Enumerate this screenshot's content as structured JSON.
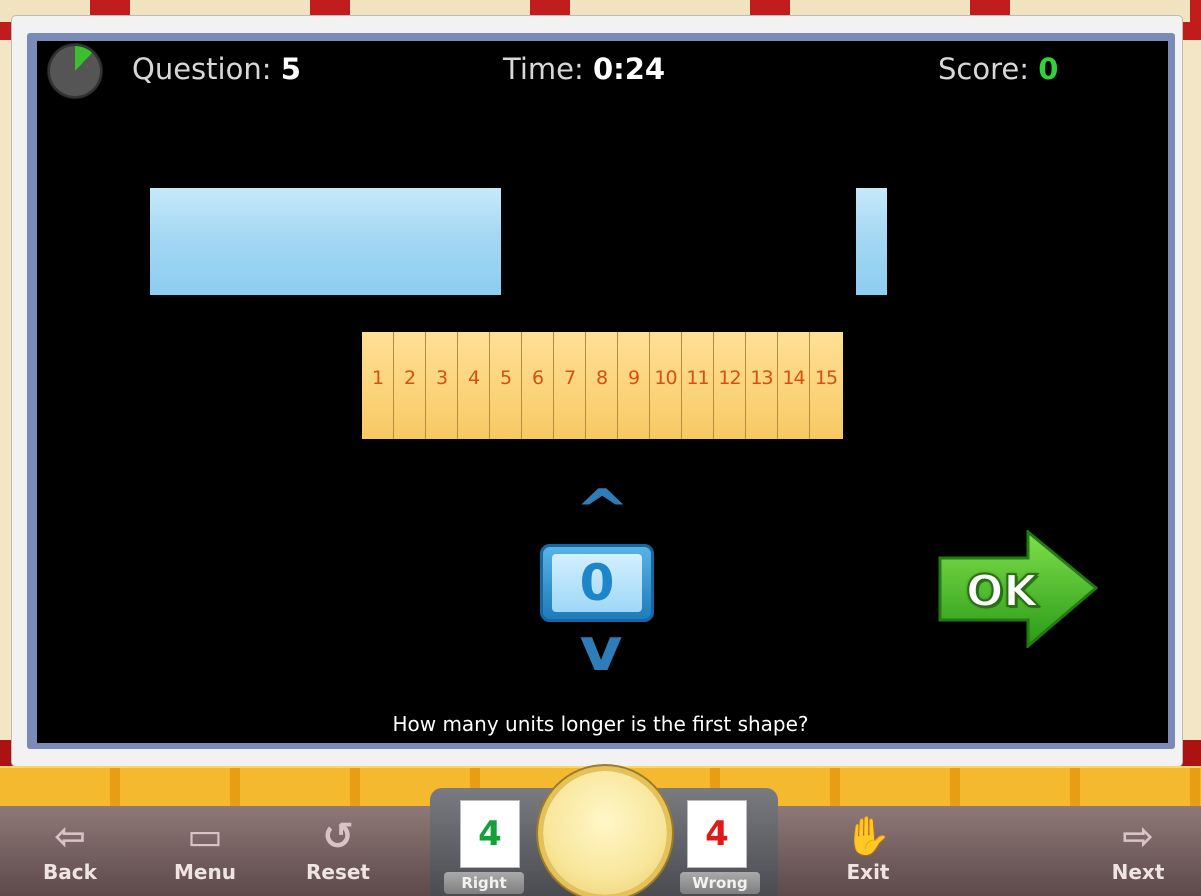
{
  "hud": {
    "question_label": "Question:",
    "question_value": "5",
    "time_label": "Time:",
    "time_value": "0:24",
    "score_label": "Score:",
    "score_value": "0"
  },
  "ruler": {
    "numbers": [
      "1",
      "2",
      "3",
      "4",
      "5",
      "6",
      "7",
      "8",
      "9",
      "10",
      "11",
      "12",
      "13",
      "14",
      "15"
    ]
  },
  "answer": {
    "value": "0"
  },
  "ok_button": {
    "label": "OK"
  },
  "prompt": "How many units longer is the first shape?",
  "toolbar": {
    "back": "Back",
    "menu": "Menu",
    "reset": "Reset",
    "exit": "Exit",
    "next": "Next"
  },
  "scoreboard": {
    "right_count": "4",
    "right_label": "Right",
    "wrong_count": "4",
    "wrong_label": "Wrong"
  },
  "colors": {
    "shape": "#a5d8f3",
    "ruler": "#f7c964",
    "ok": "#3cbf22",
    "score": "#2fd23a"
  }
}
